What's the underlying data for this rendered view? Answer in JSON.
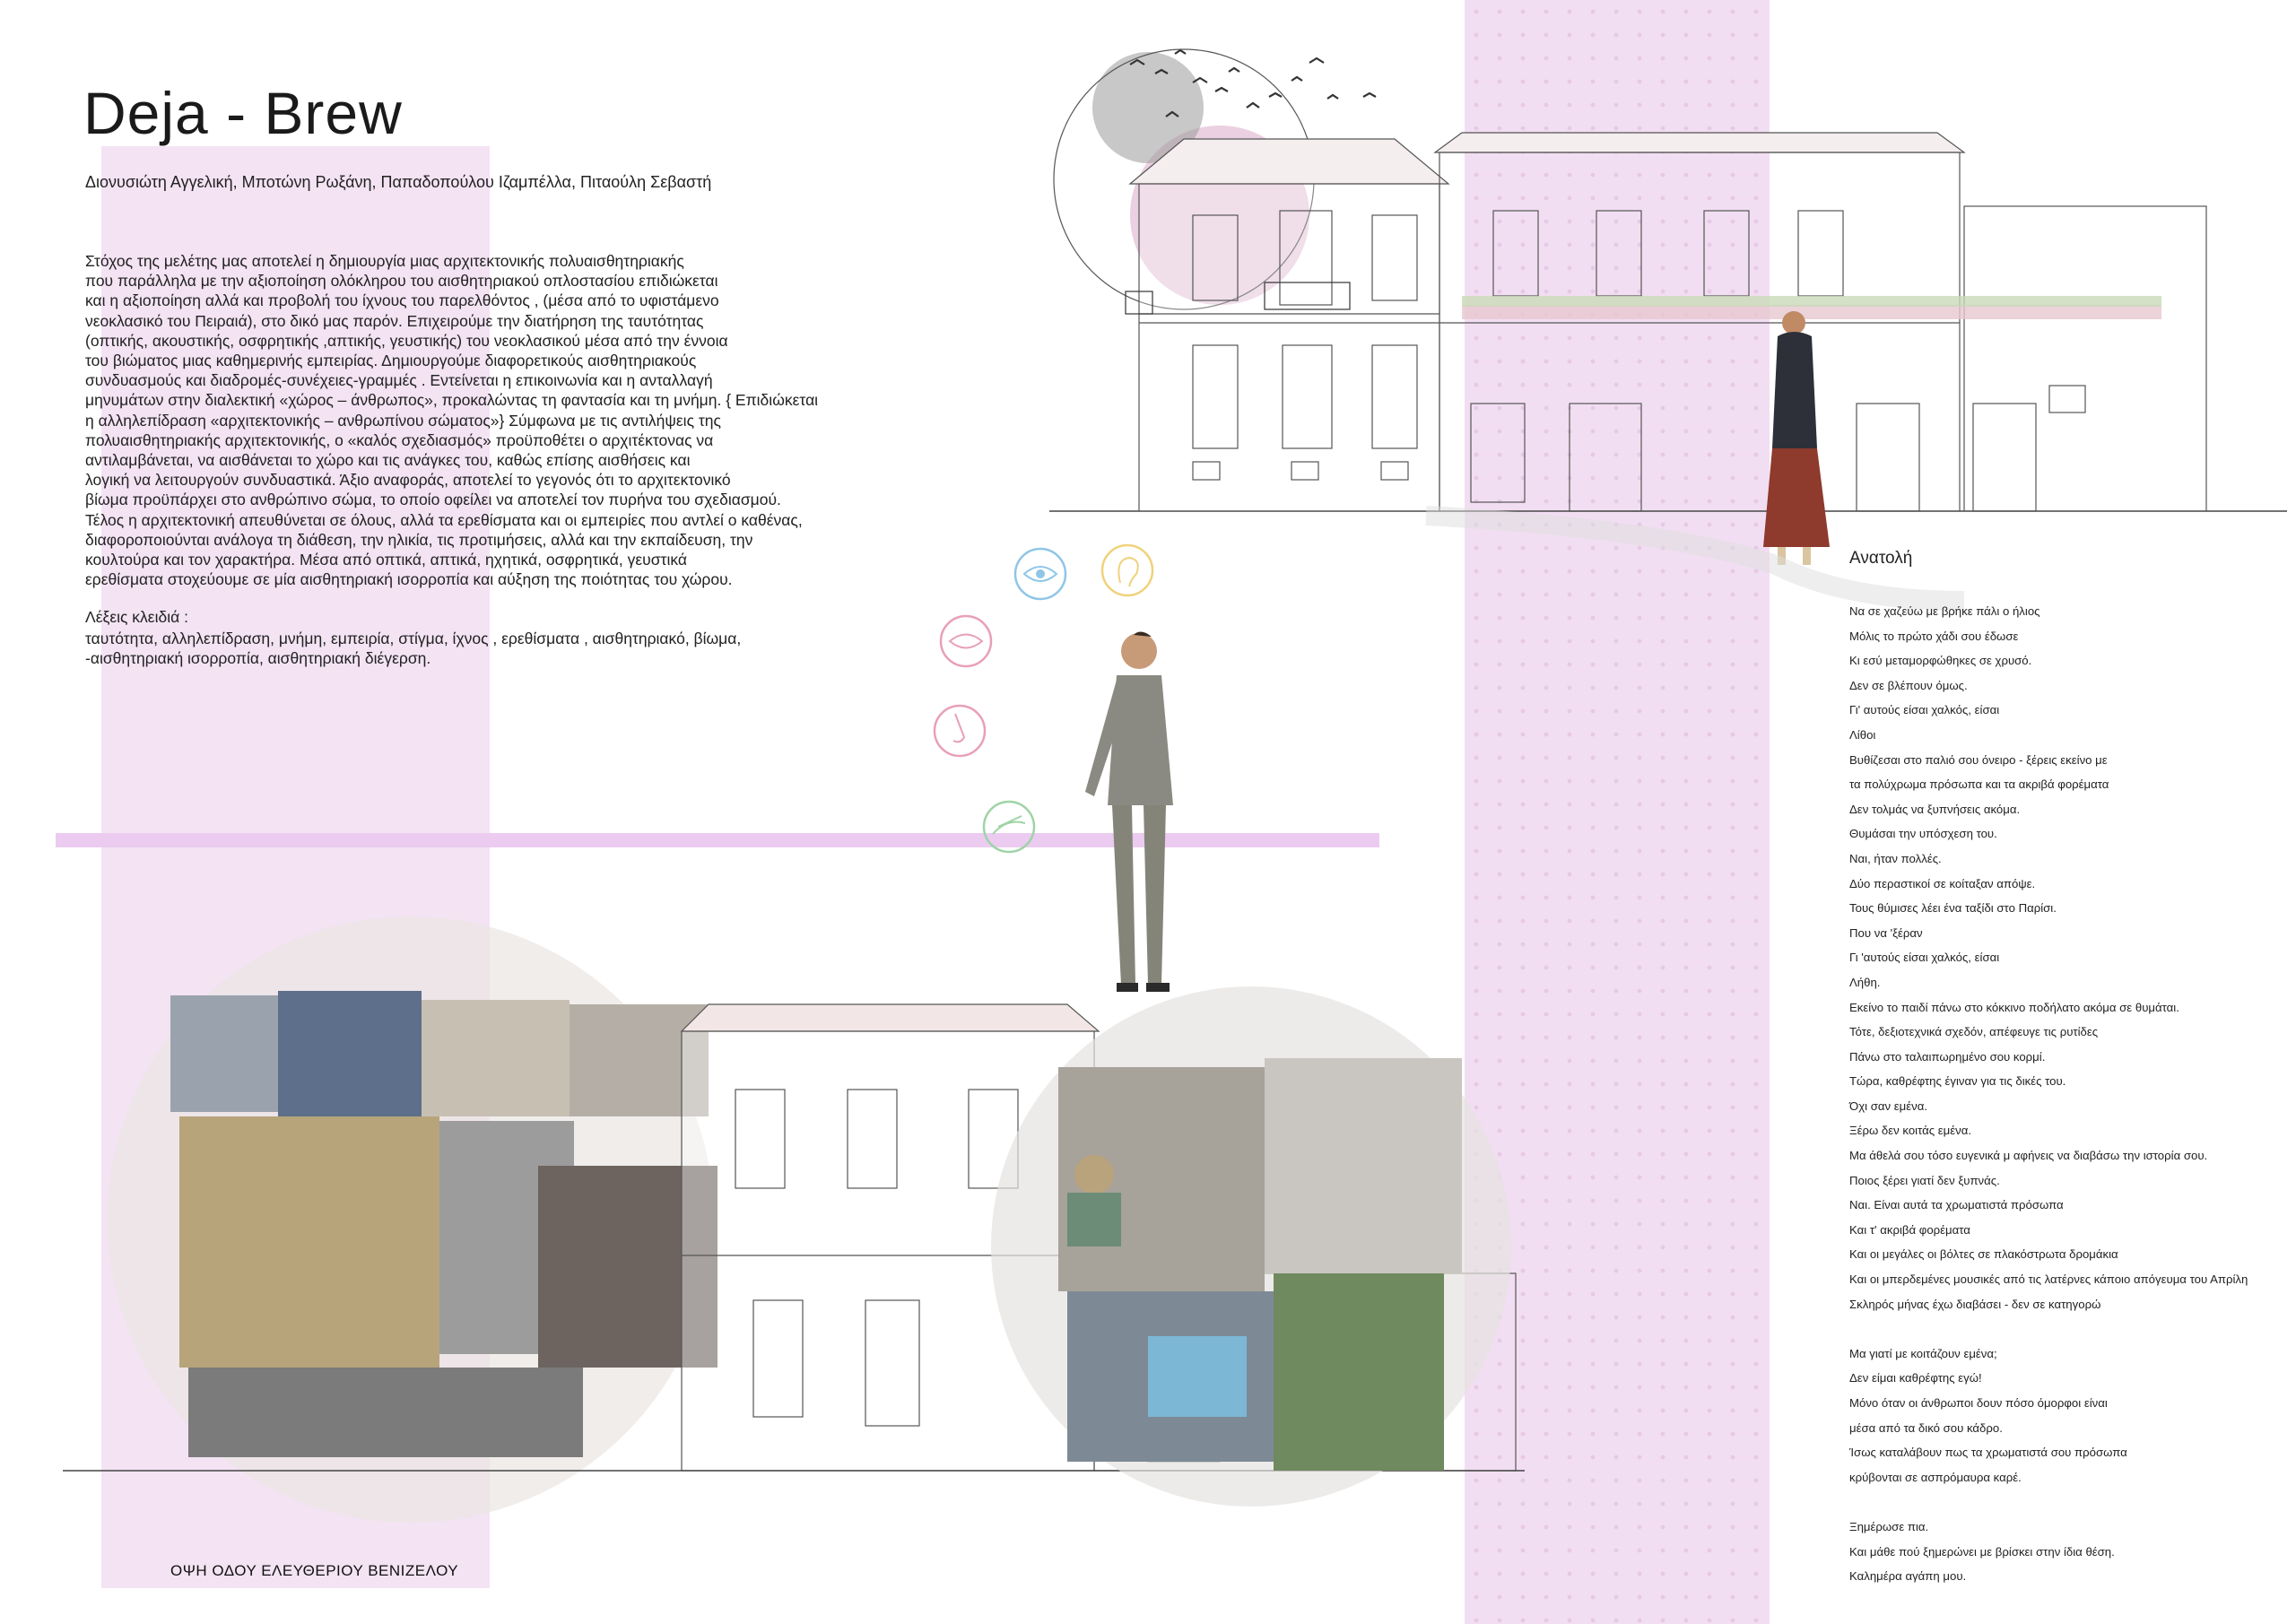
{
  "title": "Deja - Brew",
  "authors": "Διονυσιώτη Αγγελική, Μποτώνη Ρωξάνη, Παπαδοπούλου Ιζαμπέλλα, Πιταούλη Σεβαστή",
  "abstract_lines": [
    "Στόχος της μελέτης μας αποτελεί η δημιουργία μιας αρχιτεκτονικής πολυαισθητηριακής",
    "που παράλληλα με την αξιοποίηση ολόκληρου του αισθητηριακού οπλοστασίου επιδιώκεται",
    "και η αξιοποίηση αλλά και προβολή του ίχνους του παρελθόντος , (μέσα από το υφιστάμενο",
    "νεοκλασικό του Πειραιά), στο δικό μας παρόν. Επιχειρούμε την διατήρηση της ταυτότητας",
    "(οπτικής, ακουστικής, οσφρητικής ,απτικής, γευστικής) του νεοκλασικού μέσα από την έννοια",
    "του βιώματος μιας καθημερινής εμπειρίας. Δημιουργούμε διαφορετικούς αισθητηριακούς",
    " συνδυασμούς και διαδρομές-συνέχειες-γραμμές . Εντείνεται η επικοινωνία και η ανταλλαγή",
    "μηνυμάτων στην διαλεκτική «χώρος – άνθρωπος», προκαλώντας τη φαντασία και τη μνήμη. { Επιδιώκεται",
    "η αλληλεπίδραση «αρχιτεκτονικής – ανθρωπίνου σώματος»} Σύμφωνα με τις αντιλήψεις της",
    "πολυαισθητηριακής αρχιτεκτονικής, ο «καλός σχεδιασμός» προϋποθέτει ο αρχιτέκτονας να",
    "αντιλαμβάνεται, να αισθάνεται το χώρο και τις ανάγκες του, καθώς επίσης αισθήσεις και",
    "λογική να λειτουργούν συνδυαστικά. Άξιο αναφοράς, αποτελεί το γεγονός ότι το αρχιτεκτονικό",
    "βίωμα προϋπάρχει στο ανθρώπινο σώμα, το οποίο οφείλει να αποτελεί τον πυρήνα του σχεδιασμού.",
    "Τέλος η αρχιτεκτονική απευθύνεται σε όλους, αλλά τα ερεθίσματα και οι εμπειρίες που αντλεί ο καθένας,",
    "διαφοροποιούνται ανάλογα τη διάθεση, την ηλικία, τις προτιμήσεις, αλλά και την εκπαίδευση, την",
    "κουλτούρα και τον χαρακτήρα. Μέσα από οπτικά, απτικά, ηχητικά, οσφρητικά, γευστικά",
    "ερεθίσματα στοχεύουμε σε μία αισθητηριακή ισορροπία και αύξηση της ποιότητας του χώρου."
  ],
  "keywords_label": "Λέξεις κλειδιά :",
  "keywords_lines": [
    "ταυτότητα, αλληλεπίδραση, μνήμη, εμπειρία, στίγμα, ίχνος , ερεθίσματα , αισθητηριακό, βίωμα,",
    "-αισθητηριακή ισορροπία, αισθητηριακή διέγερση."
  ],
  "poem_title": "Ανατολή",
  "poem_lines": [
    "Να σε χαζεύω με βρήκε πάλι ο ήλιος",
    "Μόλις το πρώτο χάδι σου έδωσε",
    "Κι εσύ μεταμορφώθηκες σε χρυσό.",
    " Δεν σε βλέπουν όμως.",
    "Γι' αυτούς είσαι χαλκός, είσαι",
    "Λίθοι",
    "Βυθίζεσαι στο παλιό σου όνειρο - ξέρεις εκείνο με",
    "τα πολύχρωμα πρόσωπα και τα ακριβά φορέματα",
    "Δεν τολμάς να ξυπνήσεις ακόμα.",
    "Θυμάσαι την υπόσχεση του.",
    "Ναι, ήταν πολλές.",
    "Δύο περαστικοί σε κοίταξαν απόψε.",
    "Τους θύμισες λέει ένα ταξίδι στο Παρίσι.",
    "Που να 'ξέραν",
    "Γι 'αυτούς είσαι χαλκός, είσαι",
    "Λήθη.",
    "Εκείνο το παιδί πάνω στο κόκκινο ποδήλατο ακόμα σε θυμάται.",
    "Τότε, δεξιοτεχνικά σχεδόν, απέφευγε τις ρυτίδες",
    "Πάνω στο ταλαιπωρημένο σου κορμί.",
    "Τώρα, καθρέφτης έγιναν για τις δικές του.",
    "Όχι σαν εμένα.",
    "Ξέρω δεν κοιτάς εμένα.",
    "Μα άθελά σου τόσο ευγενικά μ αφήνεις να διαβάσω την ιστορία σου.",
    "Ποιος ξέρει γιατί δεν ξυπνάς.",
    "Ναι. Είναι αυτά τα χρωματιστά πρόσωπα",
    "Και τ' ακριβά φορέματα",
    "Και οι μεγάλες οι βόλτες σε πλακόστρωτα δρομάκια",
    "Και οι μπερδεμένες μουσικές από τις λατέρνες κάποιο απόγευμα του Απρίλη",
    "Σκληρός μήνας έχω διαβάσει - δεν σε κατηγορώ",
    "",
    "Μα γιατί με κοιτάζουν εμένα;",
    "Δεν είμαι καθρέφτης εγώ!",
    "Μόνο όταν οι άνθρωποι δουν πόσο όμορφοι είναι",
    "μέσα από τα δικό σου κάδρο.",
    "Ίσως καταλάβουν πως τα χρωματιστά σου πρόσωπα",
    "κρύβονται σε ασπρόμαυρα καρέ.",
    "",
    "Ξημέρωσε πια.",
    "Και μάθε πού ξημερώνει με βρίσκει στην ίδια θέση.",
    "Καλημέρα αγάπη μου."
  ],
  "elevation_caption": "ΟΨΗ ΟΔΟΥ ΕΛΕΥΘΕΡΙΟΥ ΒΕΝΙΖΕΛΟΥ",
  "sense_icons": [
    "eye-icon",
    "ear-icon",
    "mouth-icon",
    "nose-icon",
    "hand-icon"
  ],
  "colors": {
    "pink_strip": "#f3e3f3",
    "sun_pink": "#d9a9c6",
    "icon_blue": "#8fc6e6",
    "icon_yellow": "#f0d27a",
    "icon_pink": "#e8a0b6",
    "icon_green": "#9fd3a6",
    "skirt": "#8e3a2c"
  }
}
